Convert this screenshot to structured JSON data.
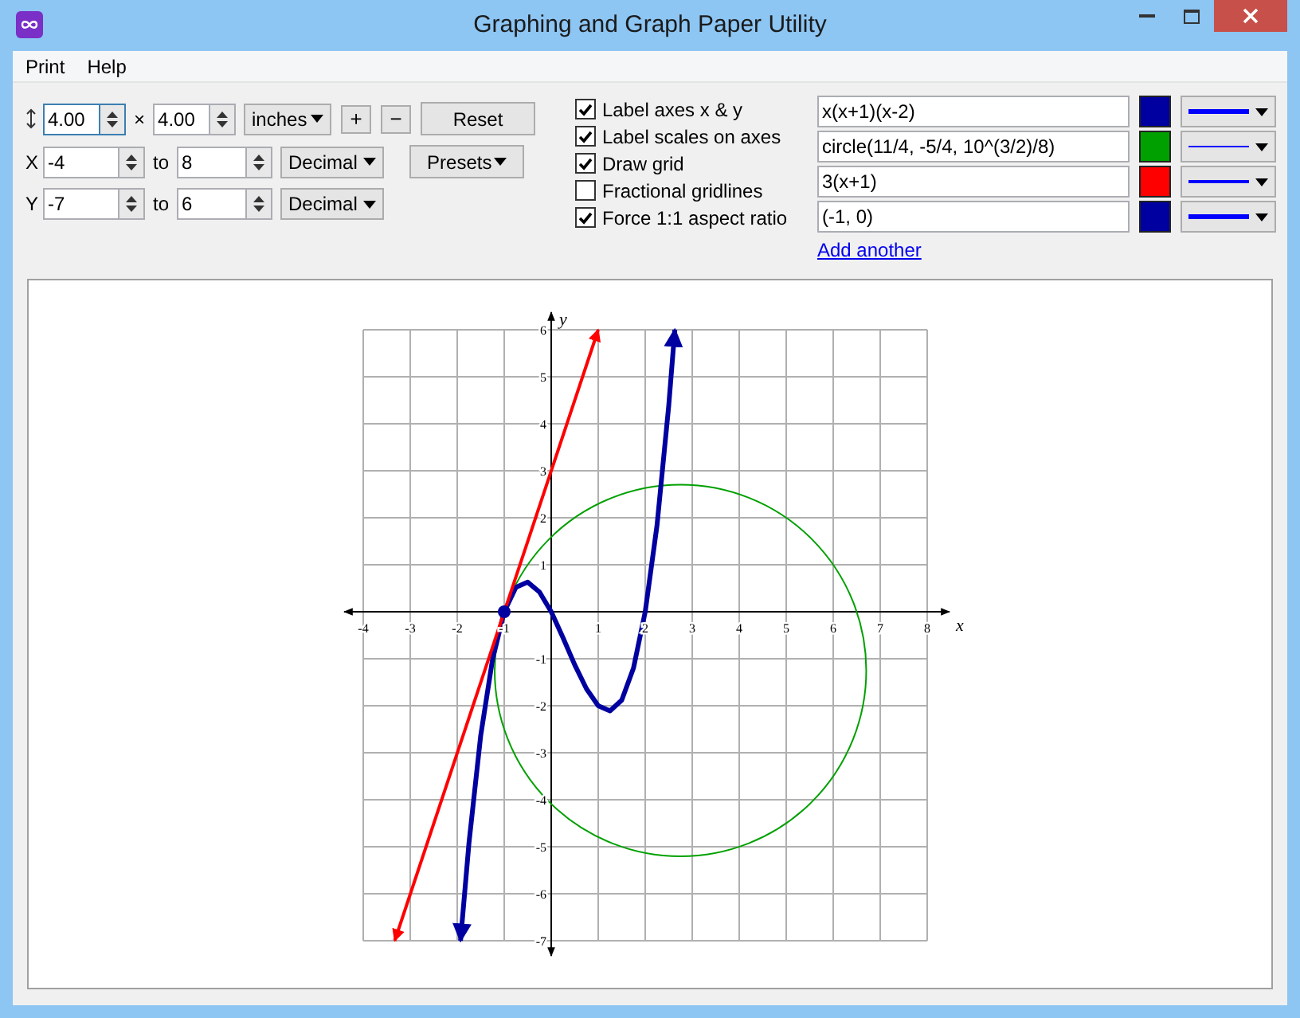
{
  "window": {
    "title": "Graphing and Graph Paper Utility"
  },
  "menu": [
    {
      "label": "Print"
    },
    {
      "label": "Help"
    }
  ],
  "size": {
    "width": {
      "value": "4.00",
      "focused": true
    },
    "times": "×",
    "height": {
      "value": "4.00",
      "focused": false
    },
    "unit": "inches",
    "zoom_in": "+",
    "zoom_out": "−",
    "reset": "Reset"
  },
  "ranges": [
    {
      "axis": "X",
      "from": "-4",
      "to_label": "to",
      "to": "8",
      "format": "Decimal"
    },
    {
      "axis": "Y",
      "from": "-7",
      "to_label": "to",
      "to": "6",
      "format": "Decimal"
    }
  ],
  "presets": "Presets",
  "options": [
    {
      "label": "Label axes x & y",
      "checked": true
    },
    {
      "label": "Label scales on axes",
      "checked": true
    },
    {
      "label": "Draw grid",
      "checked": true
    },
    {
      "label": "Fractional gridlines",
      "checked": false
    },
    {
      "label": "Force 1:1 aspect ratio",
      "checked": true
    }
  ],
  "functions": [
    {
      "expression": "x(x+1)(x-2)",
      "color": "#0000a0",
      "kind": "thick"
    },
    {
      "expression": "circle(11/4, -5/4, 10^(3/2)/8)",
      "color": "#00a000",
      "kind": "thin"
    },
    {
      "expression": "3(x+1)",
      "color": "#ff0000",
      "kind": "medium"
    },
    {
      "expression": "(-1, 0)",
      "color": "#0000a0",
      "kind": "thick"
    }
  ],
  "add_another": "Add another",
  "graph": {
    "chart_data": {
      "type": "line",
      "grid": true,
      "xlabel": "x",
      "ylabel": "y",
      "xlim": [
        -4,
        8
      ],
      "ylim": [
        -7,
        6
      ],
      "xticks": [
        -4,
        -3,
        -2,
        -1,
        1,
        2,
        3,
        4,
        5,
        6,
        7,
        8
      ],
      "yticks": [
        -7,
        -6,
        -5,
        -4,
        -3,
        -2,
        -1,
        1,
        2,
        3,
        4,
        5,
        6
      ],
      "series": [
        {
          "color": "#0000a0",
          "x": [
            -1.93,
            -1.75,
            -1.5,
            -1.25,
            -1,
            -0.75,
            -0.5,
            -0.25,
            0,
            0.25,
            0.5,
            0.75,
            1,
            1.25,
            1.5,
            1.75,
            2,
            2.25,
            2.5,
            2.63
          ],
          "values": [
            -7,
            -4.92,
            -2.63,
            -1.02,
            0,
            0.52,
            0.63,
            0.42,
            0,
            -0.55,
            -1.13,
            -1.64,
            -2,
            -2.11,
            -1.88,
            -1.2,
            0,
            1.83,
            4.38,
            6
          ]
        },
        {
          "color": "#ff0000",
          "x": [
            -3.33,
            1
          ],
          "values": [
            -7,
            6
          ]
        },
        {
          "color": "#0000a0",
          "marker": true,
          "x": [
            -1
          ],
          "values": [
            0
          ]
        }
      ]
    }
  }
}
